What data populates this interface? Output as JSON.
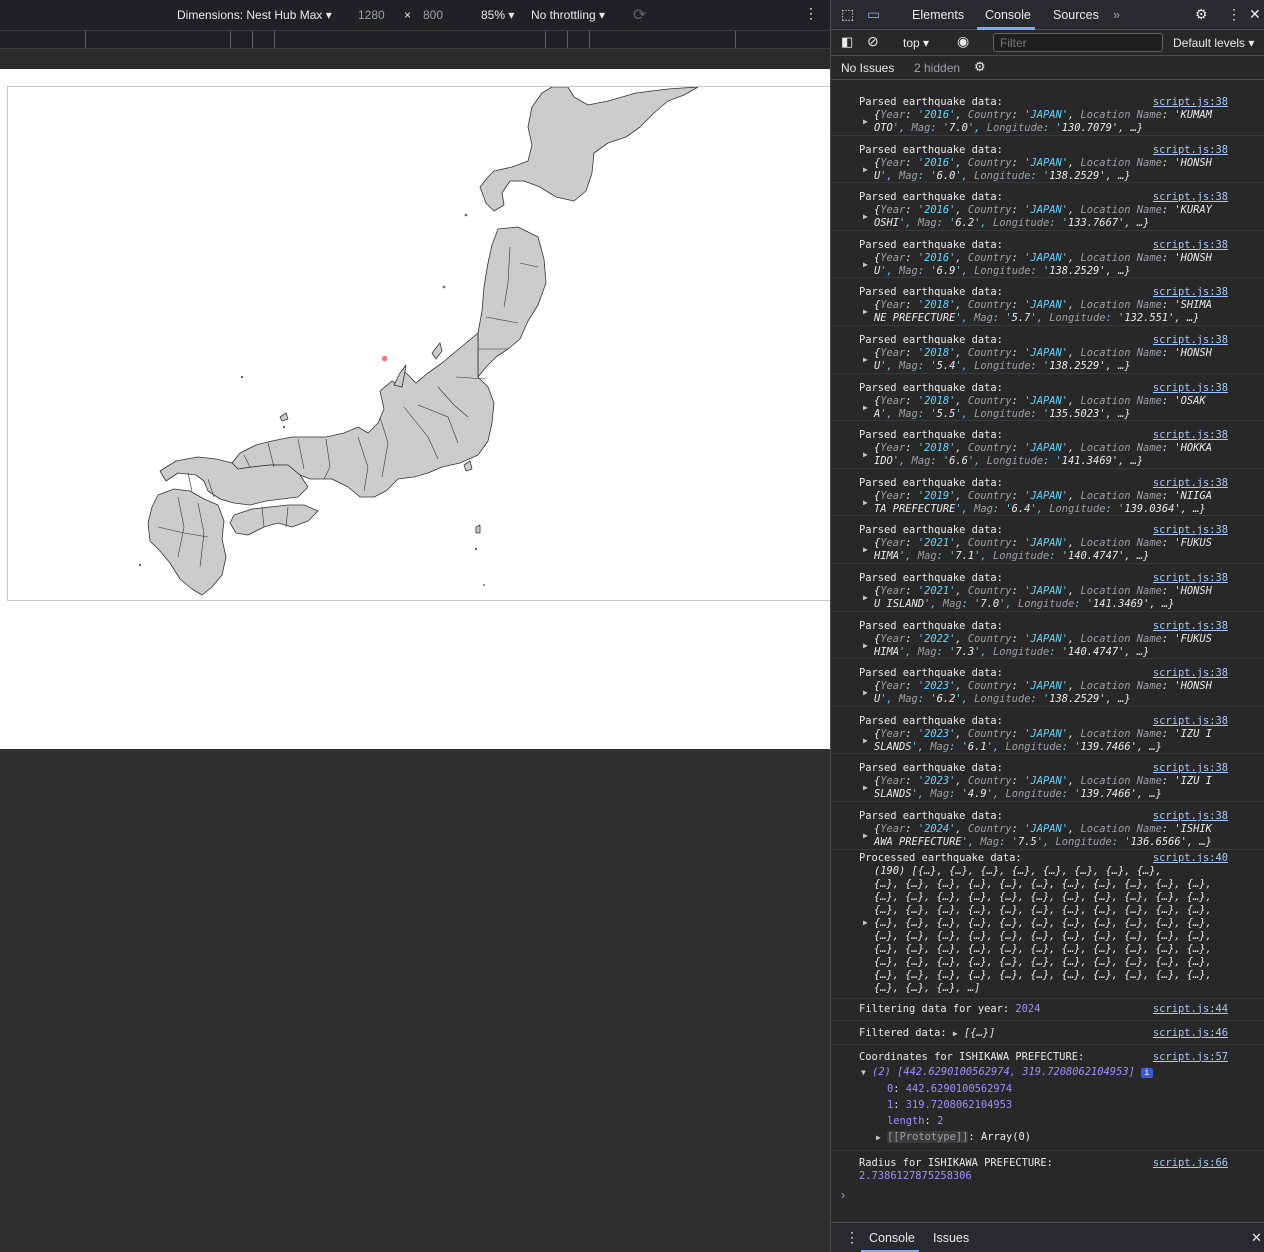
{
  "device_toolbar": {
    "dimensions_label": "Dimensions: Nest Hub Max",
    "width": "1280",
    "height": "800",
    "times": "×",
    "zoom": "85%",
    "throttling": "No throttling"
  },
  "map": {
    "marker_color": "#ff4d4d",
    "land_color": "#cccccc",
    "border_color": "#333333"
  },
  "devtools": {
    "tabs": [
      "Elements",
      "Console",
      "Sources"
    ],
    "active_tab": "Console",
    "context": "top",
    "filter_placeholder": "Filter",
    "levels": "Default levels",
    "no_issues": "No Issues",
    "hidden": "2 hidden",
    "drawer_tabs": [
      "Console",
      "Issues"
    ]
  },
  "console": {
    "parsed_header": "Parsed earthquake data:",
    "parsed_src": "script.js:38",
    "parsed": [
      {
        "line1": "{Year: '2016', Country: 'JAPAN', Location Name: 'KUMAM",
        "line2": "OTO', Mag: '7.0', Longitude: '130.7079', …}"
      },
      {
        "line1": "{Year: '2016', Country: 'JAPAN', Location Name: 'HONSH",
        "line2": "U', Mag: '6.0', Longitude: '138.2529', …}"
      },
      {
        "line1": "{Year: '2016', Country: 'JAPAN', Location Name: 'KURAY",
        "line2": "OSHI', Mag: '6.2', Longitude: '133.7667', …}"
      },
      {
        "line1": "{Year: '2016', Country: 'JAPAN', Location Name: 'HONSH",
        "line2": "U', Mag: '6.9', Longitude: '138.2529', …}"
      },
      {
        "line1": "{Year: '2018', Country: 'JAPAN', Location Name: 'SHIMA",
        "line2": "NE PREFECTURE', Mag: '5.7', Longitude: '132.551', …}"
      },
      {
        "line1": "{Year: '2018', Country: 'JAPAN', Location Name: 'HONSH",
        "line2": "U', Mag: '5.4', Longitude: '138.2529', …}"
      },
      {
        "line1": "{Year: '2018', Country: 'JAPAN', Location Name: 'OSAK",
        "line2": "A', Mag: '5.5', Longitude: '135.5023', …}"
      },
      {
        "line1": "{Year: '2018', Country: 'JAPAN', Location Name: 'HOKKA",
        "line2": "IDO', Mag: '6.6', Longitude: '141.3469', …}"
      },
      {
        "line1": "{Year: '2019', Country: 'JAPAN', Location Name: 'NIIGA",
        "line2": "TA PREFECTURE', Mag: '6.4', Longitude: '139.0364', …}"
      },
      {
        "line1": "{Year: '2021', Country: 'JAPAN', Location Name: 'FUKUS",
        "line2": "HIMA', Mag: '7.1', Longitude: '140.4747', …}"
      },
      {
        "line1": "{Year: '2021', Country: 'JAPAN', Location Name: 'HONSH",
        "line2": "U ISLAND', Mag: '7.0', Longitude: '141.3469', …}"
      },
      {
        "line1": "{Year: '2022', Country: 'JAPAN', Location Name: 'FUKUS",
        "line2": "HIMA', Mag: '7.3', Longitude: '140.4747', …}"
      },
      {
        "line1": "{Year: '2023', Country: 'JAPAN', Location Name: 'HONSH",
        "line2": "U', Mag: '6.2', Longitude: '138.2529', …}"
      },
      {
        "line1": "{Year: '2023', Country: 'JAPAN', Location Name: 'IZU I",
        "line2": "SLANDS', Mag: '6.1', Longitude: '139.7466', …}"
      },
      {
        "line1": "{Year: '2023', Country: 'JAPAN', Location Name: 'IZU I",
        "line2": "SLANDS', Mag: '4.9', Longitude: '139.7466', …}"
      },
      {
        "line1": "{Year: '2024', Country: 'JAPAN', Location Name: 'ISHIK",
        "line2": "AWA PREFECTURE', Mag: '7.5', Longitude: '136.6566', …}"
      }
    ],
    "processed": {
      "header": "Processed earthquake data:",
      "src": "script.js:40",
      "lines": [
        "(190) [{…}, {…}, {…}, {…}, {…}, {…}, {…}, {…},",
        "{…}, {…}, {…}, {…}, {…}, {…}, {…}, {…}, {…}, {…}, {…},",
        "{…}, {…}, {…}, {…}, {…}, {…}, {…}, {…}, {…}, {…}, {…},",
        "{…}, {…}, {…}, {…}, {…}, {…}, {…}, {…}, {…}, {…}, {…},",
        "{…}, {…}, {…}, {…}, {…}, {…}, {…}, {…}, {…}, {…}, {…},",
        "{…}, {…}, {…}, {…}, {…}, {…}, {…}, {…}, {…}, {…}, {…},",
        "{…}, {…}, {…}, {…}, {…}, {…}, {…}, {…}, {…}, {…}, {…},",
        "{…}, {…}, {…}, {…}, {…}, {…}, {…}, {…}, {…}, {…}, {…},",
        "{…}, {…}, {…}, {…}, {…}, {…}, {…}, {…}, {…}, {…}, {…},",
        "{…}, {…}, {…}, …]"
      ]
    },
    "filtering": {
      "label": "Filtering data for year:",
      "year": "2024",
      "src": "script.js:44"
    },
    "filtered": {
      "label": "Filtered data:",
      "value": "[{…}]",
      "src": "script.js:46"
    },
    "coords": {
      "label": "Coordinates for ISHIKAWA PREFECTURE:",
      "src": "script.js:57",
      "summary": "(2) [442.6290100562974, 319.7208062104953]",
      "i0": "442.6290100562974",
      "i1": "319.7208062104953",
      "length": "2",
      "proto": "Array(0)"
    },
    "radius": {
      "label": "Radius for ISHIKAWA PREFECTURE:",
      "value": "2.7386127875258306",
      "src": "script.js:66"
    }
  }
}
